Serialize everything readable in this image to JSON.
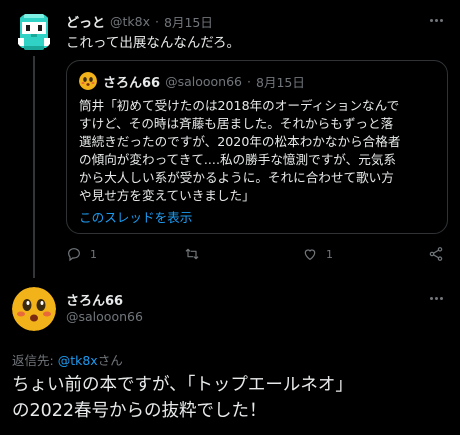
{
  "tweet": {
    "author_name": "どっと",
    "author_handle": "@tk8x",
    "separator": "·",
    "date": "8月15日",
    "text": "これって出展なんなんだろ。",
    "quote": {
      "author_name": "さろん66",
      "author_handle": "@salooon66",
      "separator": "·",
      "date": "8月15日",
      "lines": [
        "筒井「初めて受けたのは2018年のオーディションなんで",
        "すけど、その時は斉藤も居ました。それからもずっと落",
        "選続きだったのですが、2020年の松本わかなから合格者",
        "の傾向が変わってきて....私の勝手な憶測ですが、元気系",
        "から大人しい系が受かるように。それに合わせて歌い方",
        "や見せ方を変えていきました」"
      ],
      "show_thread": "このスレッドを表示"
    },
    "actions": {
      "reply_count": "1",
      "retweet_count": "",
      "like_count": "1",
      "reply_icon": "reply-icon",
      "retweet_icon": "retweet-icon",
      "like_icon": "heart-icon",
      "share_icon": "share-icon"
    }
  },
  "reply_tweet": {
    "author_name": "さろん66",
    "author_handle": "@salooon66",
    "reply_prefix": "返信先: ",
    "reply_to": "@tk8x",
    "reply_suffix": "さん",
    "lines": [
      "ちょい前の本ですが、「トップエールネオ」",
      "の2022春号からの抜粋でした！"
    ]
  },
  "colors": {
    "background": "#000000",
    "text": "#e7e9ea",
    "muted": "#71767b",
    "link": "#1d9bf0",
    "border": "#2f3336"
  }
}
